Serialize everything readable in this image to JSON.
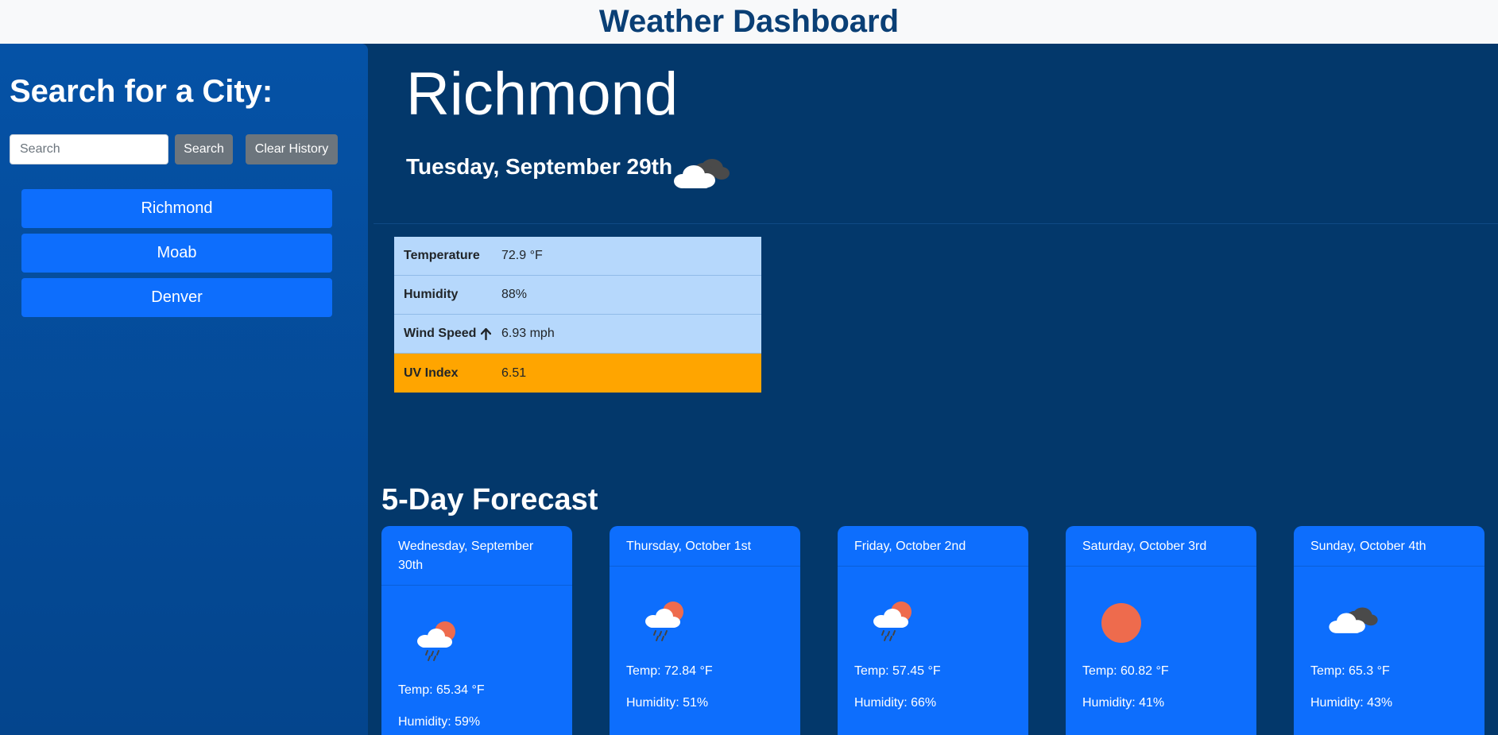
{
  "header": {
    "title": "Weather Dashboard"
  },
  "sidebar": {
    "heading": "Search for a City:",
    "search_placeholder": "Search",
    "search_button": "Search",
    "clear_button": "Clear History",
    "history": [
      "Richmond",
      "Moab",
      "Denver"
    ]
  },
  "current": {
    "city": "Richmond",
    "date": "Tuesday, September 29th",
    "icon": "cloudy-icon",
    "rows": [
      {
        "label": "Temperature",
        "value": "72.9 °F"
      },
      {
        "label": "Humidity",
        "value": "88%"
      },
      {
        "label": "Wind Speed",
        "value": "6.93 mph",
        "icon": "arrow-up-icon"
      },
      {
        "label": "UV Index",
        "value": "6.51"
      }
    ],
    "uv_color": "#ffa500"
  },
  "forecast": {
    "title": "5-Day Forecast",
    "days": [
      {
        "date": "Wednesday, September 30th",
        "icon": "rain-sun-icon",
        "temp": "Temp: 65.34 °F",
        "humidity": "Humidity: 59%"
      },
      {
        "date": "Thursday, October 1st",
        "icon": "rain-sun-icon",
        "temp": "Temp: 72.84 °F",
        "humidity": "Humidity: 51%"
      },
      {
        "date": "Friday, October 2nd",
        "icon": "rain-sun-icon",
        "temp": "Temp: 57.45 °F",
        "humidity": "Humidity: 66%"
      },
      {
        "date": "Saturday, October 3rd",
        "icon": "sun-icon",
        "temp": "Temp: 60.82 °F",
        "humidity": "Humidity: 41%"
      },
      {
        "date": "Sunday, October 4th",
        "icon": "cloudy-icon",
        "temp": "Temp: 65.3 °F",
        "humidity": "Humidity: 43%"
      }
    ]
  },
  "colors": {
    "accent": "#0d6efd",
    "background": "#03386b",
    "sidebar": "#0552a6",
    "table": "#b6d8fc"
  }
}
